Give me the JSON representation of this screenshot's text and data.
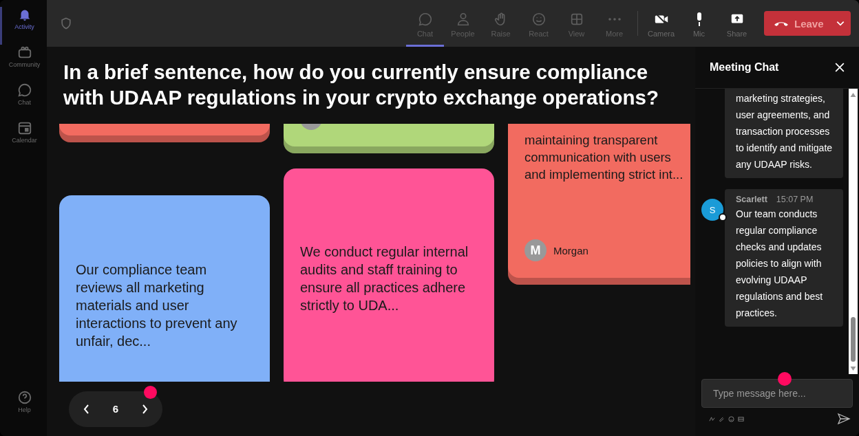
{
  "rail": {
    "items": [
      {
        "label": "Activity",
        "selected": true
      },
      {
        "label": "Community",
        "selected": false
      },
      {
        "label": "Chat",
        "selected": false
      },
      {
        "label": "Calendar",
        "selected": false
      }
    ],
    "help": "Help"
  },
  "toolbar": {
    "items": [
      {
        "label": "Chat",
        "selected": true
      },
      {
        "label": "People",
        "selected": false
      },
      {
        "label": "Raise",
        "selected": false
      },
      {
        "label": "React",
        "selected": false
      },
      {
        "label": "View",
        "selected": false
      },
      {
        "label": "More",
        "selected": false
      }
    ],
    "devices": [
      {
        "label": "Camera"
      },
      {
        "label": "Mic"
      },
      {
        "label": "Share"
      }
    ],
    "leave": "Leave"
  },
  "question": "In a brief sentence, how do you currently ensure compliance with UDAAP regulations in your crypto exchange operations?",
  "columns": [
    {
      "cards": [
        {
          "color": "#f26b60"
        },
        {
          "color": "#80b0f8",
          "text": "Our compliance team reviews all marketing materials and user interactions to prevent any unfair, dec..."
        }
      ]
    },
    {
      "cards": [
        {
          "color": "#b0d77a",
          "avatar": true
        },
        {
          "color": "#ff5496",
          "text": "We conduct regular internal audits and staff training to ensure all practices adhere strictly to UDA..."
        }
      ]
    },
    {
      "cards": [
        {
          "color": "#f26b60",
          "text": "maintaining transparent communication with users and implementing strict int...",
          "avatar": true,
          "initial": "M",
          "author": "Morgan"
        }
      ]
    }
  ],
  "pager": {
    "page": "6"
  },
  "chat": {
    "title": "Meeting Chat",
    "messages": [
      {
        "text": "marketing strategies, user agreements, and transaction processes to identify and mitigate any UDAAP risks."
      },
      {
        "initial": "S",
        "sender": "Scarlett",
        "time": "15:07 PM",
        "text": "Our team conducts regular compliance checks and updates policies to align with evolving UDAAP regulations and best practices."
      }
    ],
    "input": {
      "placeholder": "Type message here..."
    }
  }
}
